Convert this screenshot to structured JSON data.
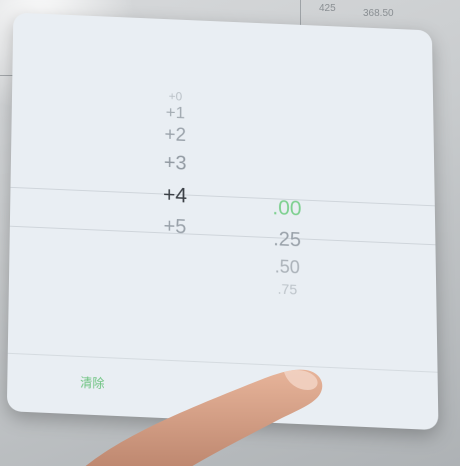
{
  "picker": {
    "main_wheel": [
      "+0",
      "+1",
      "+2",
      "+3",
      "+4",
      "+5"
    ],
    "main_selected": "+4",
    "fraction_wheel": [
      ".00",
      ".25",
      ".50",
      ".75"
    ],
    "fraction_selected": ".00"
  },
  "toolbar": {
    "clear_label": "清除"
  },
  "background": {
    "cell_a": "425",
    "cell_b": "368.50",
    "cell_c": "425"
  },
  "colors": {
    "accent": "#7dd08f",
    "selected_text": "#3b4046",
    "panel": "#e9eef3"
  },
  "icons": {
    "finger": "pointing-finger-icon"
  }
}
